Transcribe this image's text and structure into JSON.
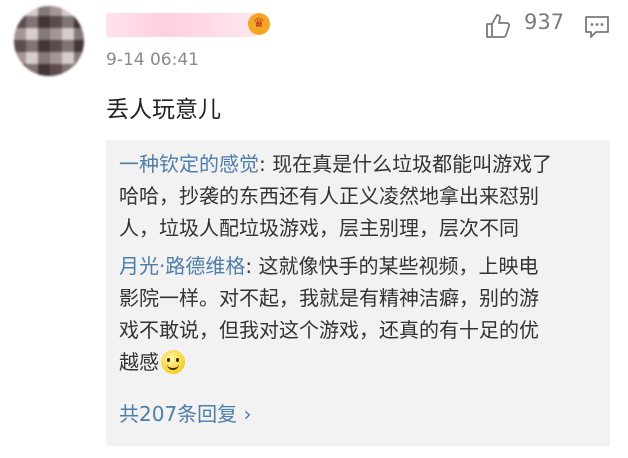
{
  "comment": {
    "timestamp": "9-14 06:41",
    "like_count": "937",
    "text": "丢人玩意儿"
  },
  "replies": [
    {
      "author": "一种钦定的感觉",
      "separator": ": ",
      "text_lines": [
        "现在真是什么垃圾都能叫游戏了",
        "哈哈，抄袭的东西还有人正义凌然地拿出来怼别",
        "人，垃圾人配垃圾游戏，层主别理，层次不同"
      ]
    },
    {
      "author": "月光·路德维格",
      "separator": ": ",
      "text_lines": [
        "这就像快手的某些视频，上映电",
        "影院一样。对不起，我就是有精神洁癖，别的游",
        "戏不敢说，但我对这个游戏，还真的有十足的优",
        "越感"
      ],
      "emoji": "smile-emoji"
    }
  ],
  "more_replies_label": "共207条回复 ›",
  "icons": {
    "like": "thumbs-up-icon",
    "comment": "comment-icon",
    "badge": "crown-badge-icon"
  },
  "colors": {
    "author_link": "#4e7da8",
    "reply_box_bg": "#f2f2f2",
    "meta_text": "#8a8a8a"
  }
}
